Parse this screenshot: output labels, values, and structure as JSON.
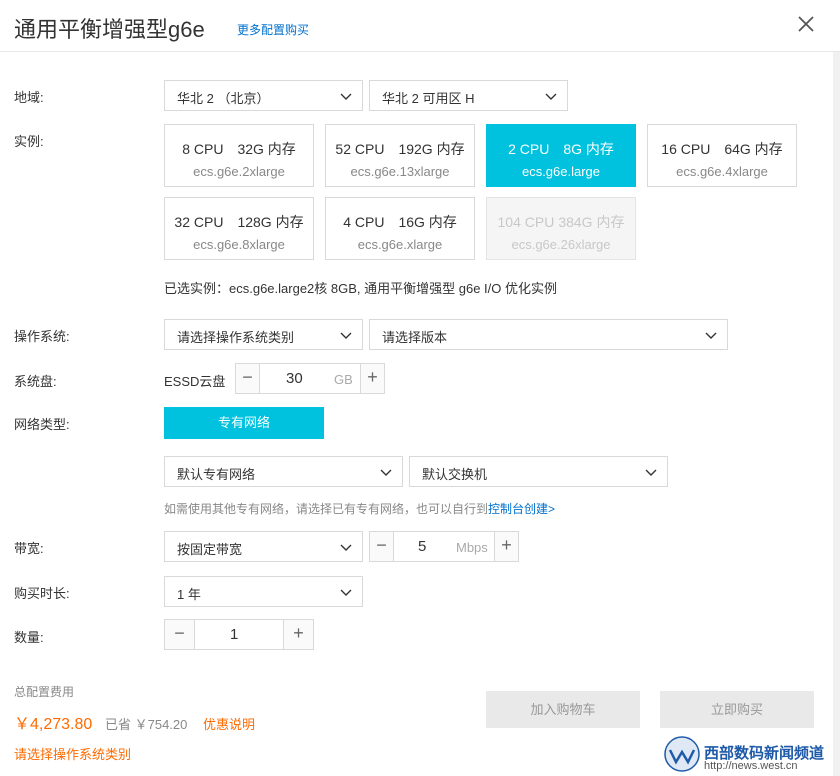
{
  "header": {
    "title": "通用平衡增强型g6e",
    "more_link": "更多配置购买"
  },
  "region": {
    "label": "地域:",
    "region_value": "华北 2 （北京）",
    "zone_value": "华北 2 可用区 H"
  },
  "instance": {
    "label": "实例:",
    "cards": [
      {
        "cpu": "8 CPU",
        "mem": "32G 内存",
        "model": "ecs.g6e.2xlarge",
        "state": "normal"
      },
      {
        "cpu": "52 CPU",
        "mem": "192G 内存",
        "model": "ecs.g6e.13xlarge",
        "state": "normal"
      },
      {
        "cpu": "2 CPU",
        "mem": "8G 内存",
        "model": "ecs.g6e.large",
        "state": "selected"
      },
      {
        "cpu": "16 CPU",
        "mem": "64G 内存",
        "model": "ecs.g6e.4xlarge",
        "state": "normal"
      },
      {
        "cpu": "32 CPU",
        "mem": "128G 内存",
        "model": "ecs.g6e.8xlarge",
        "state": "normal"
      },
      {
        "cpu": "4 CPU",
        "mem": "16G 内存",
        "model": "ecs.g6e.xlarge",
        "state": "normal"
      },
      {
        "cpu": "104 CPU",
        "mem": "384G 内存",
        "model": "ecs.g6e.26xlarge",
        "state": "disabled"
      }
    ],
    "selected_summary": "已选实例：ecs.g6e.large2核 8GB, 通用平衡增强型 g6e I/O 优化实例"
  },
  "os": {
    "label": "操作系统:",
    "type_placeholder": "请选择操作系统类别",
    "version_placeholder": "请选择版本"
  },
  "disk": {
    "label": "系统盘:",
    "type": "ESSD云盘",
    "size": "30",
    "unit": "GB"
  },
  "network": {
    "label": "网络类型:",
    "type_button": "专有网络",
    "vpc_value": "默认专有网络",
    "switch_value": "默认交换机",
    "tip_text": "如需使用其他专有网络，请选择已有专有网络，也可以自行到",
    "tip_link": "控制台创建>"
  },
  "bandwidth": {
    "label": "带宽:",
    "mode_value": "按固定带宽",
    "value": "5",
    "unit": "Mbps"
  },
  "duration": {
    "label": "购买时长:",
    "value": "1 年"
  },
  "quantity": {
    "label": "数量:",
    "value": "1"
  },
  "footer": {
    "fee_label": "总配置费用",
    "price": "￥4,273.80",
    "saved": "已省 ￥754.20",
    "promo": "优惠说明",
    "warning": "请选择操作系统类别",
    "add_cart": "加入购物车",
    "buy_now": "立即购买"
  },
  "watermark": {
    "text": "西部数码新闻频道",
    "url": "http://news.west.cn"
  },
  "colors": {
    "accent": "#00c1de",
    "price": "#ff6a00",
    "link": "#0070cc"
  }
}
